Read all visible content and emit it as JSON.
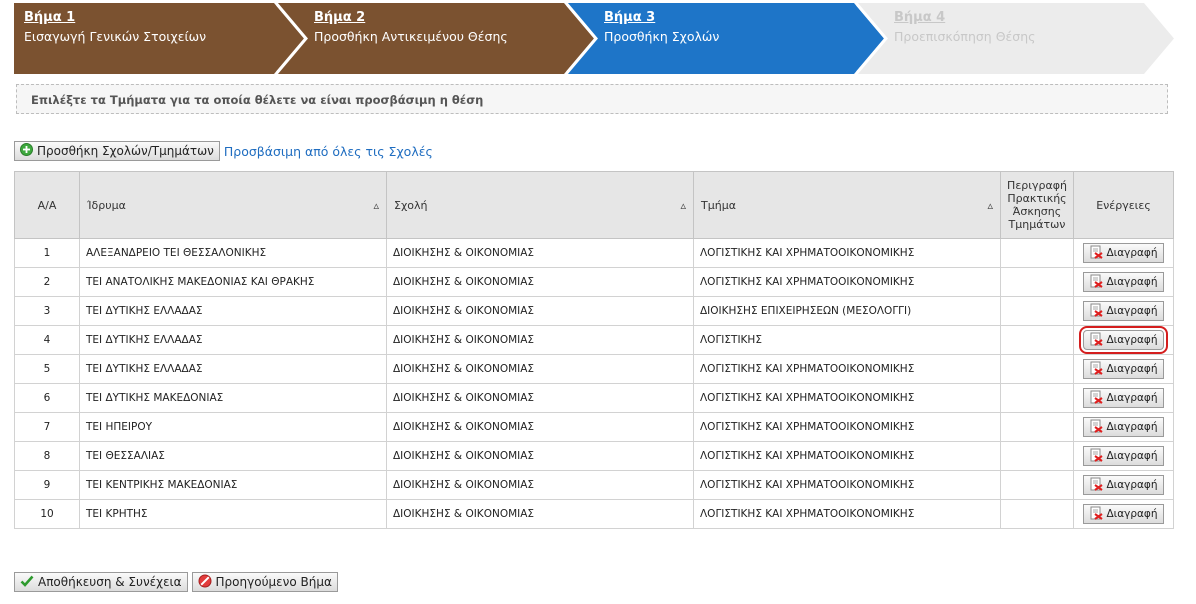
{
  "steps": [
    {
      "num": "Βήμα 1",
      "label": "Εισαγωγή Γενικών Στοιχείων",
      "state": "done",
      "color": "#7b5230"
    },
    {
      "num": "Βήμα 2",
      "label": "Προσθήκη Αντικειμένου Θέσης",
      "state": "done",
      "color": "#7b5230"
    },
    {
      "num": "Βήμα 3",
      "label": "Προσθήκη Σχολών",
      "state": "active",
      "color": "#1e75c8"
    },
    {
      "num": "Βήμα 4",
      "label": "Προεπισκόπηση Θέσης",
      "state": "pending",
      "color": "#ececec"
    }
  ],
  "instruction": "Επιλέξτε τα Τμήματα για τα οποία θέλετε να είναι προσβάσιμη η θέση",
  "add_button_label": "Προσθήκη Σχολών/Τμημάτων",
  "all_schools_link": "Προσβάσιμη από όλες τις Σχολές",
  "table": {
    "headers": {
      "aa": "Α/Α",
      "institution": "Ίδρυμα",
      "school": "Σχολή",
      "department": "Τμήμα",
      "description": "Περιγραφή Πρακτικής Άσκησης Τμημάτων",
      "actions": "Ενέργειες"
    },
    "sort_icon": "▵",
    "delete_label": "Διαγραφή",
    "rows": [
      {
        "aa": "1",
        "institution": "ΑΛΕΞΑΝΔΡΕΙΟ ΤΕΙ ΘΕΣΣΑΛΟΝΙΚΗΣ",
        "school": "ΔΙΟΙΚΗΣΗΣ & ΟΙΚΟΝΟΜΙΑΣ",
        "department": "ΛΟΓΙΣΤΙΚΗΣ ΚΑΙ ΧΡΗΜΑΤΟΟΙΚΟΝΟΜΙΚΗΣ",
        "description": ""
      },
      {
        "aa": "2",
        "institution": "ΤΕΙ ΑΝΑΤΟΛΙΚΗΣ ΜΑΚΕΔΟΝΙΑΣ ΚΑΙ ΘΡΑΚΗΣ",
        "school": "ΔΙΟΙΚΗΣΗΣ & ΟΙΚΟΝΟΜΙΑΣ",
        "department": "ΛΟΓΙΣΤΙΚΗΣ ΚΑΙ ΧΡΗΜΑΤΟΟΙΚΟΝΟΜΙΚΗΣ",
        "description": ""
      },
      {
        "aa": "3",
        "institution": "ΤΕΙ ΔΥΤΙΚΗΣ ΕΛΛΑΔΑΣ",
        "school": "ΔΙΟΙΚΗΣΗΣ & ΟΙΚΟΝΟΜΙΑΣ",
        "department": "ΔΙΟΙΚΗΣΗΣ ΕΠΙΧΕΙΡΗΣΕΩΝ (ΜΕΣΟΛΟΓΓΙ)",
        "description": ""
      },
      {
        "aa": "4",
        "institution": "ΤΕΙ ΔΥΤΙΚΗΣ ΕΛΛΑΔΑΣ",
        "school": "ΔΙΟΙΚΗΣΗΣ & ΟΙΚΟΝΟΜΙΑΣ",
        "department": "ΛΟΓΙΣΤΙΚΗΣ",
        "description": ""
      },
      {
        "aa": "5",
        "institution": "ΤΕΙ ΔΥΤΙΚΗΣ ΕΛΛΑΔΑΣ",
        "school": "ΔΙΟΙΚΗΣΗΣ & ΟΙΚΟΝΟΜΙΑΣ",
        "department": "ΛΟΓΙΣΤΙΚΗΣ ΚΑΙ ΧΡΗΜΑΤΟΟΙΚΟΝΟΜΙΚΗΣ",
        "description": ""
      },
      {
        "aa": "6",
        "institution": "ΤΕΙ ΔΥΤΙΚΗΣ ΜΑΚΕΔΟΝΙΑΣ",
        "school": "ΔΙΟΙΚΗΣΗΣ & ΟΙΚΟΝΟΜΙΑΣ",
        "department": "ΛΟΓΙΣΤΙΚΗΣ ΚΑΙ ΧΡΗΜΑΤΟΟΙΚΟΝΟΜΙΚΗΣ",
        "description": ""
      },
      {
        "aa": "7",
        "institution": "ΤΕΙ ΗΠΕΙΡΟΥ",
        "school": "ΔΙΟΙΚΗΣΗΣ & ΟΙΚΟΝΟΜΙΑΣ",
        "department": "ΛΟΓΙΣΤΙΚΗΣ ΚΑΙ ΧΡΗΜΑΤΟΟΙΚΟΝΟΜΙΚΗΣ",
        "description": ""
      },
      {
        "aa": "8",
        "institution": "ΤΕΙ ΘΕΣΣΑΛΙΑΣ",
        "school": "ΔΙΟΙΚΗΣΗΣ & ΟΙΚΟΝΟΜΙΑΣ",
        "department": "ΛΟΓΙΣΤΙΚΗΣ ΚΑΙ ΧΡΗΜΑΤΟΟΙΚΟΝΟΜΙΚΗΣ",
        "description": ""
      },
      {
        "aa": "9",
        "institution": "ΤΕΙ ΚΕΝΤΡΙΚΗΣ ΜΑΚΕΔΟΝΙΑΣ",
        "school": "ΔΙΟΙΚΗΣΗΣ & ΟΙΚΟΝΟΜΙΑΣ",
        "department": "ΛΟΓΙΣΤΙΚΗΣ ΚΑΙ ΧΡΗΜΑΤΟΟΙΚΟΝΟΜΙΚΗΣ",
        "description": ""
      },
      {
        "aa": "10",
        "institution": "ΤΕΙ ΚΡΗΤΗΣ",
        "school": "ΔΙΟΙΚΗΣΗΣ & ΟΙΚΟΝΟΜΙΑΣ",
        "department": "ΛΟΓΙΣΤΙΚΗΣ ΚΑΙ ΧΡΗΜΑΤΟΟΙΚΟΝΟΜΙΚΗΣ",
        "description": ""
      }
    ]
  },
  "save_button_label": "Αποθήκευση & Συνέχεια",
  "prev_button_label": "Προηγούμενο Βήμα",
  "icons": {
    "add": "add-circle-icon",
    "delete": "delete-doc-icon",
    "save": "checkmark-icon",
    "prev": "no-entry-icon"
  },
  "colors": {
    "step_done": "#7b5230",
    "step_active": "#1e75c8",
    "step_pending": "#ececec",
    "link": "#1f6dc0",
    "highlight": "#d41e1e"
  }
}
